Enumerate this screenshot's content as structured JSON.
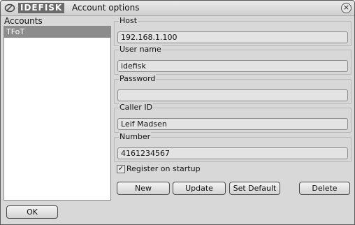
{
  "window": {
    "brand": "IDEFISK",
    "title": "Account options",
    "close_glyph": "⊗",
    "close_icon": "close-icon",
    "app_icon": "idefisk-logo-icon"
  },
  "accounts": {
    "label": "Accounts",
    "items": [
      {
        "label": "TFoT",
        "selected": true
      }
    ]
  },
  "fields": {
    "host": {
      "label": "Host",
      "value": "192.168.1.100"
    },
    "user_name": {
      "label": "User name",
      "value": "idefisk"
    },
    "password": {
      "label": "Password",
      "value": ""
    },
    "caller_id": {
      "label": "Caller ID",
      "value": "Leif Madsen"
    },
    "number": {
      "label": "Number",
      "value": "4161234567"
    }
  },
  "register": {
    "label": "Register on startup",
    "checked": true,
    "check_glyph": "☑"
  },
  "buttons": {
    "new": "New",
    "update": "Update",
    "set_default": "Set Default",
    "delete": "Delete",
    "ok": "OK"
  },
  "colors": {
    "window_bg": "#d8d8d8",
    "selection_bg": "#8c8c8c",
    "field_bg": "#e3e3e3"
  }
}
